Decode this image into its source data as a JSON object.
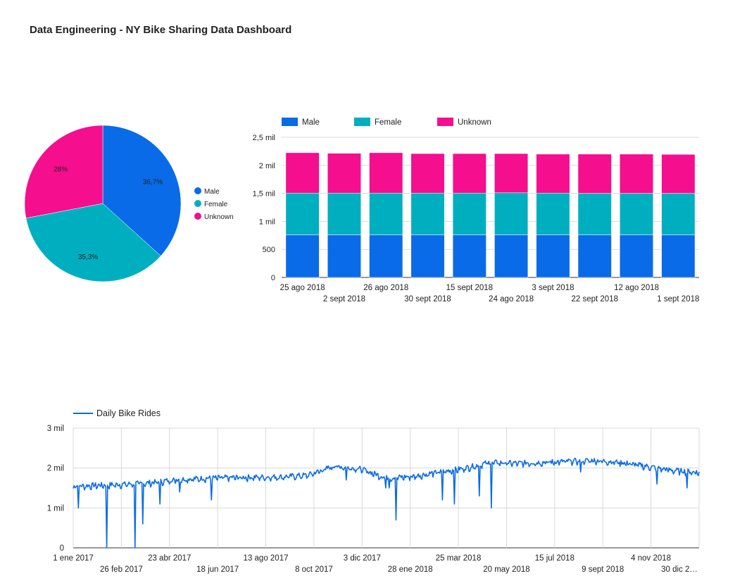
{
  "dashboard": {
    "title": "Data Engineering - NY Bike Sharing Data Dashboard"
  },
  "chart_data": [
    {
      "type": "pie",
      "categories": [
        "Male",
        "Female",
        "Unknown"
      ],
      "values": [
        36.7,
        35.3,
        28.0
      ],
      "labels": [
        "36,7%",
        "35,3%",
        "28%"
      ],
      "colors": [
        "#0a6be8",
        "#00afbf",
        "#f50e8e"
      ],
      "legend": "right"
    },
    {
      "type": "bar",
      "stacked": true,
      "categories": [
        "25 ago 2018",
        "2 sept 2018",
        "26 ago 2018",
        "30 sept 2018",
        "15 sept 2018",
        "24 ago 2018",
        "3 sept 2018",
        "22 sept 2018",
        "12 ago 2018",
        "1 sept 2018"
      ],
      "series": [
        {
          "name": "Male",
          "color": "#0a6be8",
          "values": [
            760,
            760,
            760,
            760,
            760,
            760,
            760,
            760,
            760,
            760
          ]
        },
        {
          "name": "Female",
          "color": "#00afbf",
          "values": [
            745,
            745,
            745,
            745,
            745,
            750,
            745,
            740,
            740,
            740
          ]
        },
        {
          "name": "Unknown",
          "color": "#f50e8e",
          "values": [
            720,
            710,
            720,
            705,
            705,
            700,
            695,
            700,
            700,
            695
          ]
        }
      ],
      "ylim": [
        0,
        2500
      ],
      "yticks": [
        0,
        500,
        1000,
        1500,
        2000,
        2500
      ],
      "ytick_labels": [
        "0",
        "500",
        "1 mil",
        "1,5 mil",
        "2 mil",
        "2,5 mil"
      ],
      "legend": "top-left",
      "grid": true
    },
    {
      "type": "line",
      "series": [
        {
          "name": "Daily Bike Rides",
          "color": "#0a6be8"
        }
      ],
      "x_range": [
        "2017-01-01",
        "2018-12-31"
      ],
      "xtick_labels": [
        "1 ene 2017",
        "26 feb 2017",
        "23 abr 2017",
        "18 jun 2017",
        "13 ago 2017",
        "8 oct 2017",
        "3 dic 2017",
        "28 ene 2018",
        "25 mar 2018",
        "20 may 2018",
        "15 jul 2018",
        "9 sept 2018",
        "4 nov 2018",
        "30 dic 2…"
      ],
      "ylim": [
        0,
        3000
      ],
      "yticks": [
        0,
        1000,
        2000,
        3000
      ],
      "ytick_labels": [
        "0",
        "1 mil",
        "2 mil",
        "3 mil"
      ],
      "trend_points": [
        [
          "2017-01-01",
          1550
        ],
        [
          "2017-02-01",
          1580
        ],
        [
          "2017-03-01",
          1600
        ],
        [
          "2017-04-01",
          1640
        ],
        [
          "2017-05-01",
          1720
        ],
        [
          "2017-06-01",
          1750
        ],
        [
          "2017-07-01",
          1770
        ],
        [
          "2017-08-01",
          1780
        ],
        [
          "2017-09-01",
          1790
        ],
        [
          "2017-10-01",
          1830
        ],
        [
          "2017-11-01",
          2060
        ],
        [
          "2017-12-01",
          1990
        ],
        [
          "2018-01-01",
          1760
        ],
        [
          "2018-02-01",
          1800
        ],
        [
          "2018-03-01",
          1900
        ],
        [
          "2018-04-01",
          2000
        ],
        [
          "2018-05-01",
          2150
        ],
        [
          "2018-06-01",
          2130
        ],
        [
          "2018-07-01",
          2150
        ],
        [
          "2018-08-01",
          2180
        ],
        [
          "2018-09-01",
          2200
        ],
        [
          "2018-10-01",
          2150
        ],
        [
          "2018-11-01",
          2050
        ],
        [
          "2018-12-01",
          1950
        ],
        [
          "2018-12-31",
          1900
        ]
      ],
      "dips": [
        [
          "2017-01-07",
          1000
        ],
        [
          "2017-02-09",
          0
        ],
        [
          "2017-03-14",
          0
        ],
        [
          "2017-03-23",
          600
        ],
        [
          "2017-04-12",
          1100
        ],
        [
          "2017-05-05",
          1400
        ],
        [
          "2017-06-11",
          1200
        ],
        [
          "2017-11-15",
          1700
        ],
        [
          "2017-12-31",
          1500
        ],
        [
          "2018-01-04",
          1500
        ],
        [
          "2018-01-12",
          700
        ],
        [
          "2018-03-07",
          1200
        ],
        [
          "2018-03-21",
          1100
        ],
        [
          "2018-04-19",
          1300
        ],
        [
          "2018-05-03",
          1000
        ],
        [
          "2018-08-15",
          1900
        ],
        [
          "2018-11-12",
          1600
        ],
        [
          "2018-12-17",
          1500
        ]
      ],
      "legend": "top-left",
      "grid": true
    }
  ]
}
